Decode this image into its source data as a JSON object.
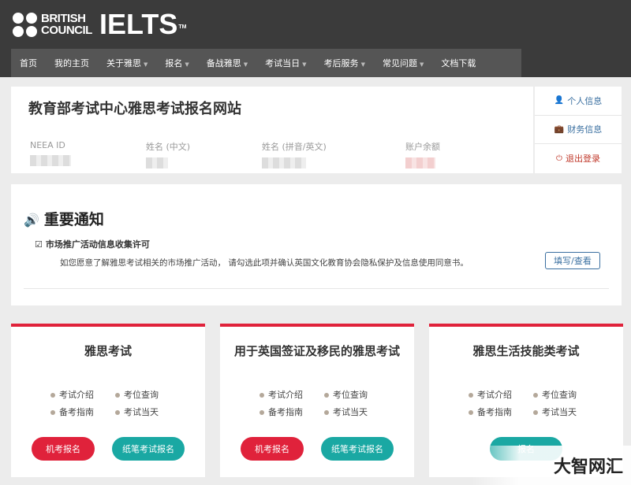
{
  "brand": {
    "line1": "BRITISH",
    "line2": "COUNCIL",
    "product": "IELTS",
    "tm": "TM"
  },
  "nav": [
    {
      "label": "首页",
      "dropdown": false
    },
    {
      "label": "我的主页",
      "dropdown": false
    },
    {
      "label": "关于雅思",
      "dropdown": true
    },
    {
      "label": "报名",
      "dropdown": true
    },
    {
      "label": "备战雅思",
      "dropdown": true
    },
    {
      "label": "考试当日",
      "dropdown": true
    },
    {
      "label": "考后服务",
      "dropdown": true
    },
    {
      "label": "常见问题",
      "dropdown": true
    },
    {
      "label": "文档下载",
      "dropdown": false
    }
  ],
  "profile": {
    "title": "教育部考试中心雅思考试报名网站",
    "fields": [
      {
        "label": "NEEA ID"
      },
      {
        "label": "姓名 (中文)"
      },
      {
        "label": "姓名 (拼音/英文)"
      },
      {
        "label": "账户余额"
      }
    ]
  },
  "side_links": [
    {
      "label": "个人信息",
      "icon": "user-icon"
    },
    {
      "label": "财务信息",
      "icon": "briefcase-icon"
    },
    {
      "label": "退出登录",
      "icon": "power-icon"
    }
  ],
  "notice": {
    "title": "重要通知",
    "subtitle": "市场推广活动信息收集许可",
    "body": "如您愿意了解雅思考试相关的市场推广活动， 请勾选此项并确认英国文化教育协会隐私保护及信息使用同意书。",
    "button": "填写/查看"
  },
  "cards": [
    {
      "title": "雅思考试",
      "links": [
        "考试介绍",
        "考位查询",
        "备考指南",
        "考试当天"
      ],
      "buttons": [
        {
          "label": "机考报名",
          "style": "red"
        },
        {
          "label": "纸笔考试报名",
          "style": "teal"
        }
      ]
    },
    {
      "title": "用于英国签证及移民的雅思考试",
      "links": [
        "考试介绍",
        "考位查询",
        "备考指南",
        "考试当天"
      ],
      "buttons": [
        {
          "label": "机考报名",
          "style": "red"
        },
        {
          "label": "纸笔考试报名",
          "style": "teal"
        }
      ]
    },
    {
      "title": "雅思生活技能类考试",
      "links": [
        "考试介绍",
        "考位查询",
        "备考指南",
        "考试当天"
      ],
      "buttons": [
        {
          "label": "报名",
          "style": "teal"
        }
      ]
    }
  ],
  "watermark": "大智网汇",
  "colors": {
    "header": "#3b3b3b",
    "nav": "#555555",
    "accent_red": "#e0223b",
    "accent_teal": "#1aa8a3",
    "link_blue": "#3a6fa0"
  }
}
